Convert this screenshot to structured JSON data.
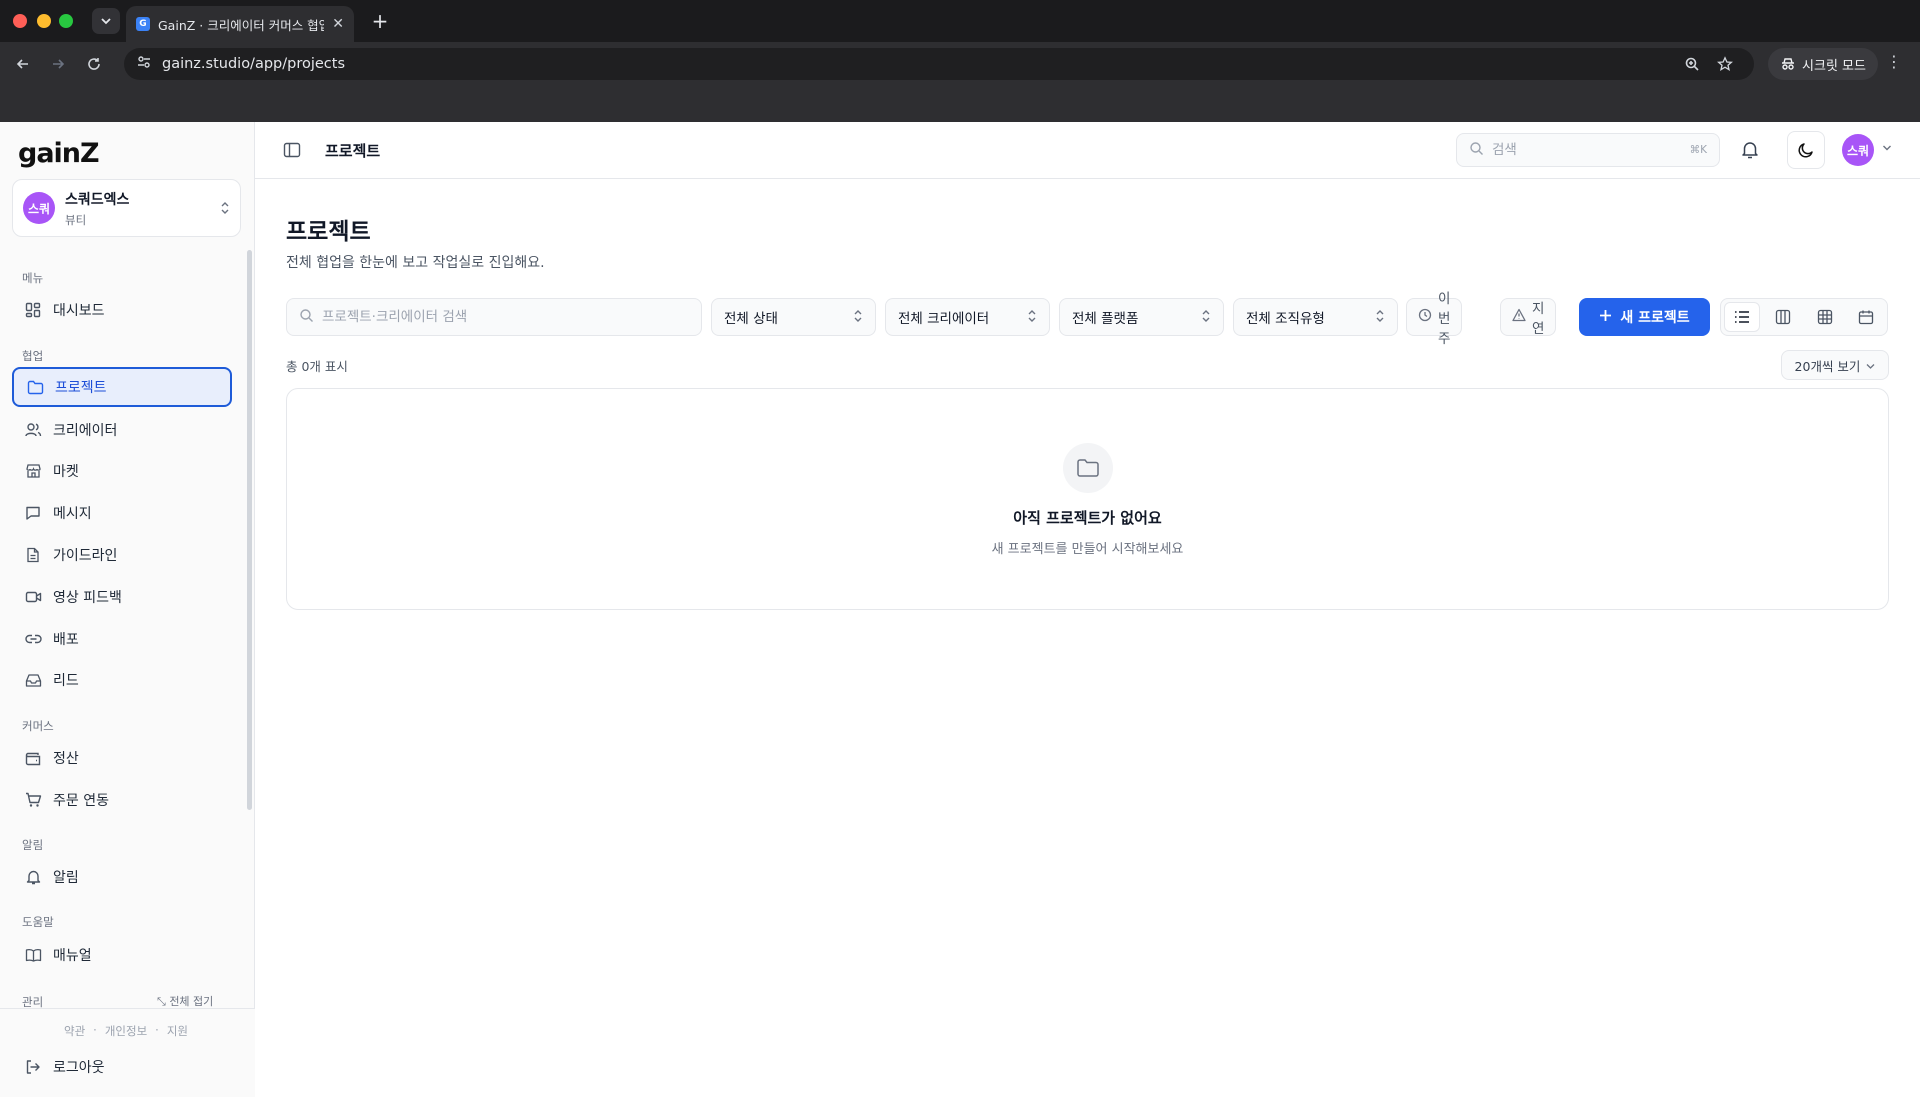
{
  "browser": {
    "tab_title": "GainZ · 크리에이터 커머스 협업 OS",
    "favicon_letter": "G",
    "url": "gainz.studio/app/projects",
    "incognito_label": "시크릿 모드"
  },
  "sidebar": {
    "logo": "gainZ",
    "workspace": {
      "avatar": "스쿼",
      "name": "스쿼드엑스",
      "category": "뷰티"
    },
    "sections": {
      "menu": "메뉴",
      "collab": "협업",
      "commerce": "커머스",
      "alerts": "알림",
      "help": "도움말",
      "admin": "관리"
    },
    "items": {
      "dashboard": "대시보드",
      "projects": "프로젝트",
      "creators": "크리에이터",
      "market": "마켓",
      "messages": "메시지",
      "guidelines": "가이드라인",
      "video_feedback": "영상 피드백",
      "distribution": "배포",
      "leads": "리드",
      "settlement": "정산",
      "order_sync": "주문 연동",
      "notifications": "알림",
      "manual": "매뉴얼"
    },
    "collapse_all": "전체 접기",
    "footer": {
      "terms": "약관",
      "privacy": "개인정보",
      "support": "지원",
      "dot": "·",
      "logout": "로그아웃"
    }
  },
  "header": {
    "title": "프로젝트",
    "search_placeholder": "검색",
    "search_shortcut": "⌘K",
    "user_avatar": "스쿼"
  },
  "main": {
    "title": "프로젝트",
    "description": "전체 협업을 한눈에 보고 작업실로 진입해요.",
    "search_placeholder": "프로젝트·크리에이터 검색",
    "filters": {
      "status": "전체 상태",
      "creator": "전체 크리에이터",
      "platform": "전체 플랫폼",
      "org_type": "전체 조직유형",
      "this_week": "이번 주",
      "delayed": "지연"
    },
    "new_project_label": "새 프로젝트",
    "count_text": "총 0개 표시",
    "page_size": "20개씩 보기",
    "empty": {
      "title": "아직 프로젝트가 없어요",
      "subtitle": "새 프로젝트를 만들어 시작해보세요"
    }
  },
  "colors": {
    "accent": "#2563eb",
    "avatar": "#a855f7"
  }
}
